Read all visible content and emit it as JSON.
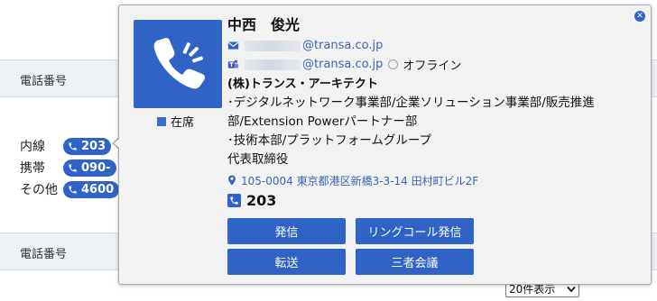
{
  "background": {
    "section_header_1": "電話番号",
    "section_header_2": "電話番号",
    "rows": [
      {
        "label": "内線",
        "value": "203"
      },
      {
        "label": "携帯",
        "value": "090-"
      },
      {
        "label": "その他",
        "value": "4600"
      }
    ],
    "page_size_select": {
      "selected": "20件表示"
    }
  },
  "popup": {
    "name": "中西　俊光",
    "email_domain": "@transa.co.jp",
    "teams_domain": "@transa.co.jp",
    "status": "オフライン",
    "presence_label": "在席",
    "company": "(株)トランス・アーキテクト",
    "departments": [
      "･デジタルネットワーク事業部/企業ソリューション事業部/販売推進部/Extension Powerパートナー部",
      "･技術本部/プラットフォームグループ"
    ],
    "title": "代表取締役",
    "address": "105-0004 東京都港区新橋3-3-14 田村町ビル2F",
    "extension": "203",
    "buttons": {
      "call": "発信",
      "ring_call": "リングコール発信",
      "transfer": "転送",
      "conference": "三者会議"
    },
    "colors": {
      "accent": "#2f63c6",
      "link": "#3b64b6"
    }
  }
}
